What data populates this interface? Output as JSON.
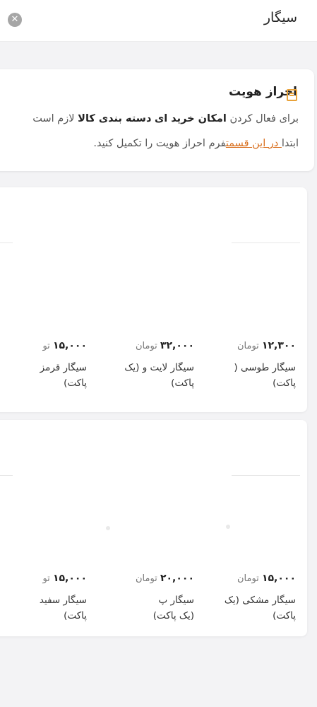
{
  "search": {
    "query": "سیگار",
    "clear_icon": "close-circle-icon"
  },
  "verify": {
    "icon": "id-card-icon",
    "title": "احراز هویت",
    "line1_part1": "برای فعال کردن",
    "line1_bold1": "امکان خرید ای",
    "line1_bold2": "دسته بندی کالا",
    "line1_part2": "لازم است",
    "line2_part1": "ابتدا",
    "line2_link": " در این قسمت",
    "line2_part2": "فرم احراز هویت را تکمیل کنید."
  },
  "products_row1": [
    {
      "price": "۱۲,۳۰۰",
      "unit": "تومان",
      "name": "سیگار طوسی (",
      "name_line2": "پاکت)"
    },
    {
      "price": "۳۲,۰۰۰",
      "unit": "تومان",
      "name": "سیگار لایت و      (یک",
      "name_line2": "پاکت)"
    },
    {
      "price": "۱۵,۰۰۰",
      "unit": "تو",
      "name": "سیگار قرمز",
      "name_line2": "پاکت)"
    }
  ],
  "products_row2": [
    {
      "price": "۱۵,۰۰۰",
      "unit": "تومان",
      "name": "سیگار مشکی    (یک",
      "name_line2": "پاکت)"
    },
    {
      "price": "۲۰,۰۰۰",
      "unit": "تومان",
      "name": "سیگار پ",
      "name_line2": "(یک پاکت)"
    },
    {
      "price": "۱۵,۰۰۰",
      "unit": "تو",
      "name": "سیگار سفید",
      "name_line2": "پاکت)"
    }
  ],
  "colors": {
    "accent": "#d9701f",
    "icon": "#e8a23a",
    "background": "#f3f3f5"
  }
}
